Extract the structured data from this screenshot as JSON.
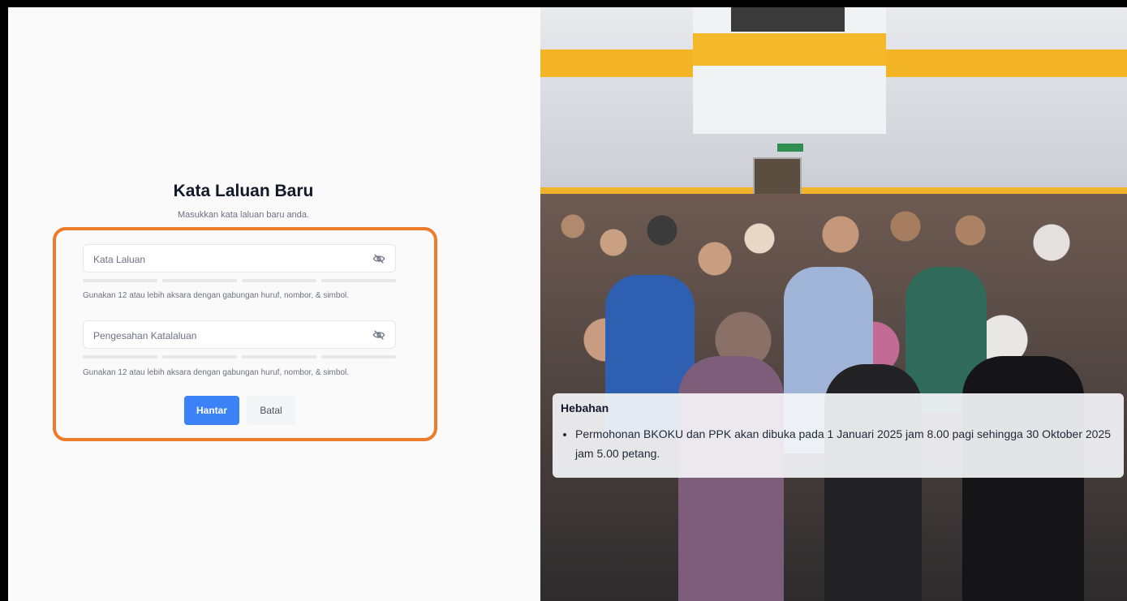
{
  "form": {
    "title": "Kata Laluan Baru",
    "subtitle": "Masukkan kata laluan baru anda.",
    "password_placeholder": "Kata Laluan",
    "password_hint": "Gunakan 12 atau lebih aksara dengan gabungan huruf, nombor, & simbol.",
    "confirm_placeholder": "Pengesahan Katalaluan",
    "confirm_hint": "Gunakan 12 atau lebih aksara dengan gabungan huruf, nombor, & simbol.",
    "submit_label": "Hantar",
    "cancel_label": "Batal"
  },
  "announcement": {
    "heading": "Hebahan",
    "items": [
      "Permohonan BKOKU dan PPK akan dibuka pada 1 Januari 2025 jam 8.00 pagi sehingga 30 Oktober 2025 jam 5.00 petang."
    ]
  },
  "icons": {
    "password_toggle": "eye-off-icon",
    "confirm_toggle": "eye-off-icon"
  },
  "colors": {
    "primary": "#3b82f6",
    "highlight": "#ec7b2c",
    "text_dark": "#111827",
    "text_muted": "#6b7280"
  }
}
